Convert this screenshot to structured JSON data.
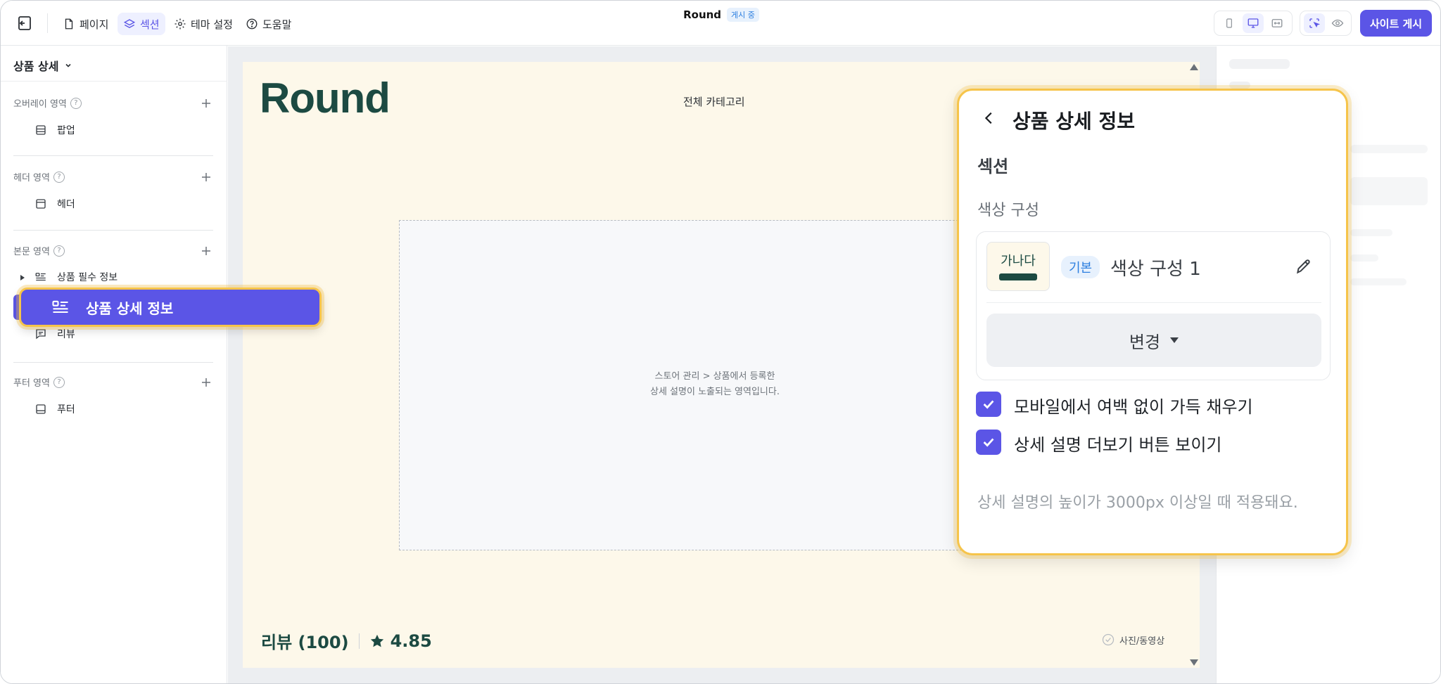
{
  "topbar": {
    "nav": [
      {
        "label": "페이지",
        "icon": "page-icon"
      },
      {
        "label": "섹션",
        "icon": "layers-icon",
        "active": true
      },
      {
        "label": "테마 설정",
        "icon": "gear-icon"
      },
      {
        "label": "도움말",
        "icon": "help-icon"
      }
    ],
    "site_name": "Round",
    "status_badge": "게시 중",
    "publish_label": "사이트 게시",
    "accent": "#5b55e6"
  },
  "sidebar": {
    "title": "상품 상세",
    "groups": [
      {
        "label": "오버레이 영역",
        "items": [
          "팝업"
        ]
      },
      {
        "label": "헤더 영역",
        "items": [
          "헤더"
        ]
      },
      {
        "label": "본문 영역",
        "items": [
          "상품 필수 정보",
          "상품 상세 정보",
          "리뷰"
        ]
      },
      {
        "label": "푸터 영역",
        "items": [
          "푸터"
        ]
      }
    ],
    "help_glyph": "?",
    "dragging_item": "상품 상세 정보"
  },
  "preview": {
    "logo": "Round",
    "all_categories": "전체 카테고리",
    "placeholder_line1": "스토어 관리 > 상품에서 등록한",
    "placeholder_line2": "상세 설명이 노출되는 영역입니다.",
    "review_label": "리뷰 (100)",
    "rating": "4.85",
    "media_filter": "사진/동영상",
    "brand_color": "#1c4a42",
    "page_bg": "#fdf8ea"
  },
  "panel": {
    "title": "상품 상세 정보",
    "section_label": "섹션",
    "color_label": "색상 구성",
    "swatch_text": "가나다",
    "default_badge": "기본",
    "color_scheme_name": "색상 구성 1",
    "change_label": "변경",
    "option1": "모바일에서 여백 없이 가득 채우기",
    "option1_checked": true,
    "option2": "상세 설명 더보기 버튼 보이기",
    "option2_checked": true,
    "hint": "상세 설명의 높이가 3000px 이상일 때 적용돼요.",
    "highlight": "#f6c44a"
  }
}
